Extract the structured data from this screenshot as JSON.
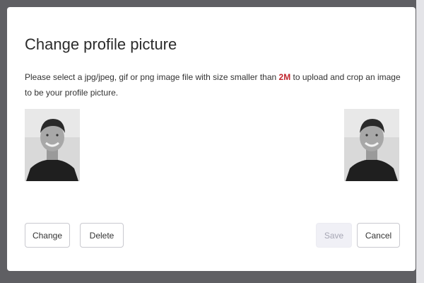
{
  "dialog": {
    "title": "Change profile picture",
    "description": {
      "before": "Please select a jpg/jpeg, gif or png image file with size smaller than ",
      "size_limit": "2M",
      "after": " to upload and crop an image to be your profile picture."
    },
    "buttons": {
      "change": "Change",
      "delete": "Delete",
      "save": "Save",
      "cancel": "Cancel"
    },
    "save_enabled": false
  },
  "colors": {
    "overlay": "#5f5f63",
    "highlight": "#c0262d",
    "save_disabled_bg": "#f0f0f6"
  }
}
